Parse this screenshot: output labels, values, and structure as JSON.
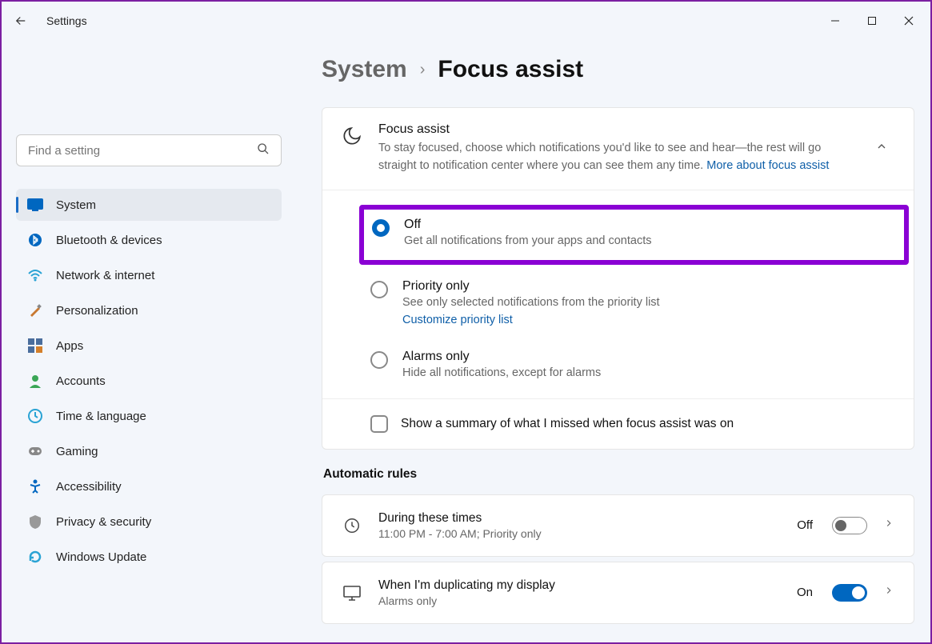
{
  "title": "Settings",
  "search": {
    "placeholder": "Find a setting"
  },
  "sidebar": {
    "items": [
      {
        "label": "System",
        "icon": "display-icon"
      },
      {
        "label": "Bluetooth & devices",
        "icon": "bluetooth-icon"
      },
      {
        "label": "Network & internet",
        "icon": "wifi-icon"
      },
      {
        "label": "Personalization",
        "icon": "brush-icon"
      },
      {
        "label": "Apps",
        "icon": "apps-icon"
      },
      {
        "label": "Accounts",
        "icon": "account-icon"
      },
      {
        "label": "Time & language",
        "icon": "clock-globe-icon"
      },
      {
        "label": "Gaming",
        "icon": "gamepad-icon"
      },
      {
        "label": "Accessibility",
        "icon": "accessibility-icon"
      },
      {
        "label": "Privacy & security",
        "icon": "shield-icon"
      },
      {
        "label": "Windows Update",
        "icon": "update-icon"
      }
    ]
  },
  "breadcrumb": {
    "parent": "System",
    "current": "Focus assist"
  },
  "focus_card": {
    "title": "Focus assist",
    "desc": "To stay focused, choose which notifications you'd like to see and hear—the rest will go straight to notification center where you can see them any time.  ",
    "link": "More about focus assist"
  },
  "radios": {
    "off": {
      "title": "Off",
      "desc": "Get all notifications from your apps and contacts"
    },
    "priority": {
      "title": "Priority only",
      "desc": "See only selected notifications from the priority list",
      "link": "Customize priority list"
    },
    "alarms": {
      "title": "Alarms only",
      "desc": "Hide all notifications, except for alarms"
    }
  },
  "summary_checkbox": {
    "label": "Show a summary of what I missed when focus assist was on"
  },
  "rules": {
    "section_title": "Automatic rules",
    "time": {
      "title": "During these times",
      "desc": "11:00 PM - 7:00 AM; Priority only",
      "state": "Off"
    },
    "display": {
      "title": "When I'm duplicating my display",
      "desc": "Alarms only",
      "state": "On"
    }
  }
}
